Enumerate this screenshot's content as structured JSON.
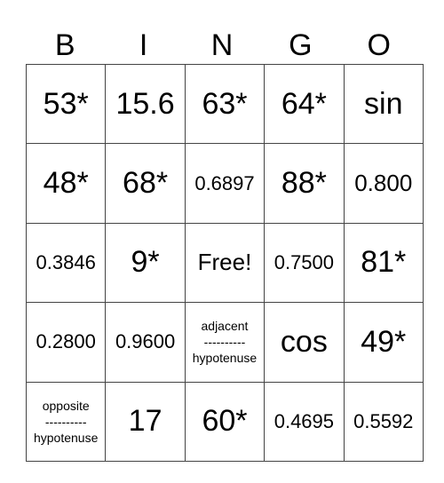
{
  "header": [
    "B",
    "I",
    "N",
    "G",
    "O"
  ],
  "cells": [
    [
      {
        "t": "53*",
        "s": "big"
      },
      {
        "t": "15.6",
        "s": "big"
      },
      {
        "t": "63*",
        "s": "big"
      },
      {
        "t": "64*",
        "s": "big"
      },
      {
        "t": "sin",
        "s": "big"
      }
    ],
    [
      {
        "t": "48*",
        "s": "big"
      },
      {
        "t": "68*",
        "s": "big"
      },
      {
        "t": "0.6897",
        "s": "num"
      },
      {
        "t": "88*",
        "s": "big"
      },
      {
        "t": "0.800",
        "s": "mid"
      }
    ],
    [
      {
        "t": "0.3846",
        "s": "num"
      },
      {
        "t": "9*",
        "s": "big"
      },
      {
        "t": "Free!",
        "s": "mid"
      },
      {
        "t": "0.7500",
        "s": "num"
      },
      {
        "t": "81*",
        "s": "big"
      }
    ],
    [
      {
        "t": "0.2800",
        "s": "num"
      },
      {
        "t": "0.9600",
        "s": "num"
      },
      {
        "t": "adjacent\n----------\nhypotenuse",
        "s": "sm"
      },
      {
        "t": "cos",
        "s": "big"
      },
      {
        "t": "49*",
        "s": "big"
      }
    ],
    [
      {
        "t": "opposite\n----------\nhypotenuse",
        "s": "sm"
      },
      {
        "t": "17",
        "s": "big"
      },
      {
        "t": "60*",
        "s": "big"
      },
      {
        "t": "0.4695",
        "s": "num"
      },
      {
        "t": "0.5592",
        "s": "num"
      }
    ]
  ]
}
